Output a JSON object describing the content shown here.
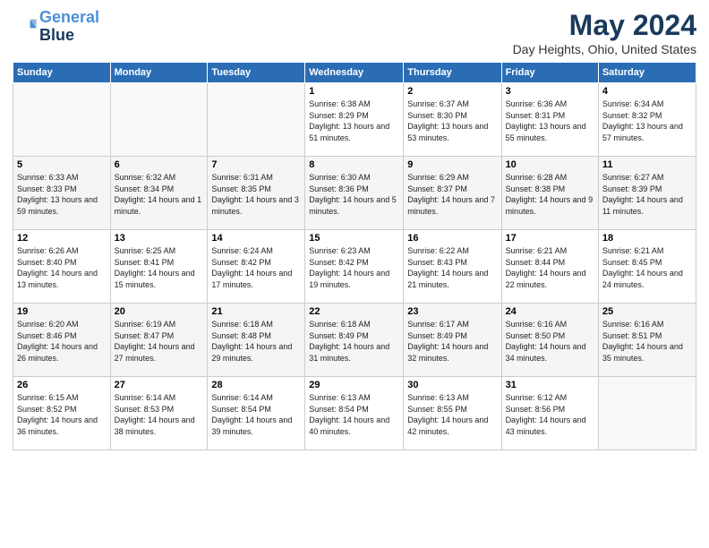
{
  "logo": {
    "line1": "General",
    "line2": "Blue"
  },
  "title": "May 2024",
  "subtitle": "Day Heights, Ohio, United States",
  "days_header": [
    "Sunday",
    "Monday",
    "Tuesday",
    "Wednesday",
    "Thursday",
    "Friday",
    "Saturday"
  ],
  "weeks": [
    [
      {
        "day": "",
        "sunrise": "",
        "sunset": "",
        "daylight": ""
      },
      {
        "day": "",
        "sunrise": "",
        "sunset": "",
        "daylight": ""
      },
      {
        "day": "",
        "sunrise": "",
        "sunset": "",
        "daylight": ""
      },
      {
        "day": "1",
        "sunrise": "Sunrise: 6:38 AM",
        "sunset": "Sunset: 8:29 PM",
        "daylight": "Daylight: 13 hours and 51 minutes."
      },
      {
        "day": "2",
        "sunrise": "Sunrise: 6:37 AM",
        "sunset": "Sunset: 8:30 PM",
        "daylight": "Daylight: 13 hours and 53 minutes."
      },
      {
        "day": "3",
        "sunrise": "Sunrise: 6:36 AM",
        "sunset": "Sunset: 8:31 PM",
        "daylight": "Daylight: 13 hours and 55 minutes."
      },
      {
        "day": "4",
        "sunrise": "Sunrise: 6:34 AM",
        "sunset": "Sunset: 8:32 PM",
        "daylight": "Daylight: 13 hours and 57 minutes."
      }
    ],
    [
      {
        "day": "5",
        "sunrise": "Sunrise: 6:33 AM",
        "sunset": "Sunset: 8:33 PM",
        "daylight": "Daylight: 13 hours and 59 minutes."
      },
      {
        "day": "6",
        "sunrise": "Sunrise: 6:32 AM",
        "sunset": "Sunset: 8:34 PM",
        "daylight": "Daylight: 14 hours and 1 minute."
      },
      {
        "day": "7",
        "sunrise": "Sunrise: 6:31 AM",
        "sunset": "Sunset: 8:35 PM",
        "daylight": "Daylight: 14 hours and 3 minutes."
      },
      {
        "day": "8",
        "sunrise": "Sunrise: 6:30 AM",
        "sunset": "Sunset: 8:36 PM",
        "daylight": "Daylight: 14 hours and 5 minutes."
      },
      {
        "day": "9",
        "sunrise": "Sunrise: 6:29 AM",
        "sunset": "Sunset: 8:37 PM",
        "daylight": "Daylight: 14 hours and 7 minutes."
      },
      {
        "day": "10",
        "sunrise": "Sunrise: 6:28 AM",
        "sunset": "Sunset: 8:38 PM",
        "daylight": "Daylight: 14 hours and 9 minutes."
      },
      {
        "day": "11",
        "sunrise": "Sunrise: 6:27 AM",
        "sunset": "Sunset: 8:39 PM",
        "daylight": "Daylight: 14 hours and 11 minutes."
      }
    ],
    [
      {
        "day": "12",
        "sunrise": "Sunrise: 6:26 AM",
        "sunset": "Sunset: 8:40 PM",
        "daylight": "Daylight: 14 hours and 13 minutes."
      },
      {
        "day": "13",
        "sunrise": "Sunrise: 6:25 AM",
        "sunset": "Sunset: 8:41 PM",
        "daylight": "Daylight: 14 hours and 15 minutes."
      },
      {
        "day": "14",
        "sunrise": "Sunrise: 6:24 AM",
        "sunset": "Sunset: 8:42 PM",
        "daylight": "Daylight: 14 hours and 17 minutes."
      },
      {
        "day": "15",
        "sunrise": "Sunrise: 6:23 AM",
        "sunset": "Sunset: 8:42 PM",
        "daylight": "Daylight: 14 hours and 19 minutes."
      },
      {
        "day": "16",
        "sunrise": "Sunrise: 6:22 AM",
        "sunset": "Sunset: 8:43 PM",
        "daylight": "Daylight: 14 hours and 21 minutes."
      },
      {
        "day": "17",
        "sunrise": "Sunrise: 6:21 AM",
        "sunset": "Sunset: 8:44 PM",
        "daylight": "Daylight: 14 hours and 22 minutes."
      },
      {
        "day": "18",
        "sunrise": "Sunrise: 6:21 AM",
        "sunset": "Sunset: 8:45 PM",
        "daylight": "Daylight: 14 hours and 24 minutes."
      }
    ],
    [
      {
        "day": "19",
        "sunrise": "Sunrise: 6:20 AM",
        "sunset": "Sunset: 8:46 PM",
        "daylight": "Daylight: 14 hours and 26 minutes."
      },
      {
        "day": "20",
        "sunrise": "Sunrise: 6:19 AM",
        "sunset": "Sunset: 8:47 PM",
        "daylight": "Daylight: 14 hours and 27 minutes."
      },
      {
        "day": "21",
        "sunrise": "Sunrise: 6:18 AM",
        "sunset": "Sunset: 8:48 PM",
        "daylight": "Daylight: 14 hours and 29 minutes."
      },
      {
        "day": "22",
        "sunrise": "Sunrise: 6:18 AM",
        "sunset": "Sunset: 8:49 PM",
        "daylight": "Daylight: 14 hours and 31 minutes."
      },
      {
        "day": "23",
        "sunrise": "Sunrise: 6:17 AM",
        "sunset": "Sunset: 8:49 PM",
        "daylight": "Daylight: 14 hours and 32 minutes."
      },
      {
        "day": "24",
        "sunrise": "Sunrise: 6:16 AM",
        "sunset": "Sunset: 8:50 PM",
        "daylight": "Daylight: 14 hours and 34 minutes."
      },
      {
        "day": "25",
        "sunrise": "Sunrise: 6:16 AM",
        "sunset": "Sunset: 8:51 PM",
        "daylight": "Daylight: 14 hours and 35 minutes."
      }
    ],
    [
      {
        "day": "26",
        "sunrise": "Sunrise: 6:15 AM",
        "sunset": "Sunset: 8:52 PM",
        "daylight": "Daylight: 14 hours and 36 minutes."
      },
      {
        "day": "27",
        "sunrise": "Sunrise: 6:14 AM",
        "sunset": "Sunset: 8:53 PM",
        "daylight": "Daylight: 14 hours and 38 minutes."
      },
      {
        "day": "28",
        "sunrise": "Sunrise: 6:14 AM",
        "sunset": "Sunset: 8:54 PM",
        "daylight": "Daylight: 14 hours and 39 minutes."
      },
      {
        "day": "29",
        "sunrise": "Sunrise: 6:13 AM",
        "sunset": "Sunset: 8:54 PM",
        "daylight": "Daylight: 14 hours and 40 minutes."
      },
      {
        "day": "30",
        "sunrise": "Sunrise: 6:13 AM",
        "sunset": "Sunset: 8:55 PM",
        "daylight": "Daylight: 14 hours and 42 minutes."
      },
      {
        "day": "31",
        "sunrise": "Sunrise: 6:12 AM",
        "sunset": "Sunset: 8:56 PM",
        "daylight": "Daylight: 14 hours and 43 minutes."
      },
      {
        "day": "",
        "sunrise": "",
        "sunset": "",
        "daylight": ""
      }
    ]
  ]
}
